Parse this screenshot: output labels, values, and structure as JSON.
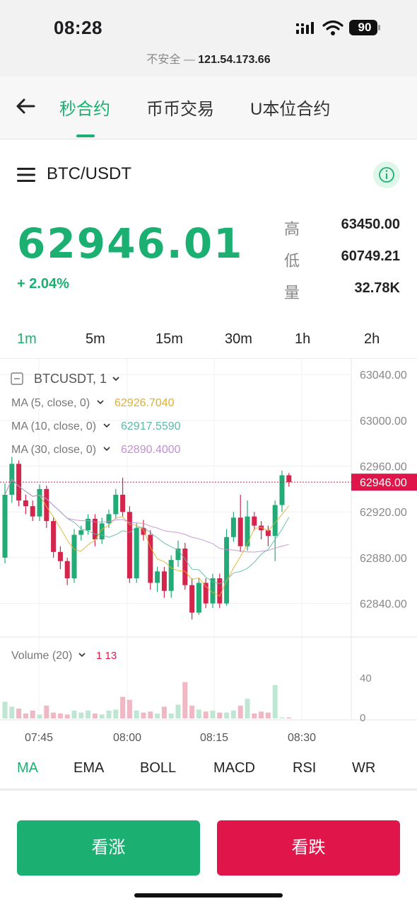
{
  "status_bar": {
    "time": "08:28",
    "battery": "90"
  },
  "url_bar": {
    "insecure": "不安全 — ",
    "address": "121.54.173.66"
  },
  "nav": {
    "tabs": [
      "秒合约",
      "币币交易",
      "U本位合约"
    ],
    "active": 0
  },
  "pair": "BTC/USDT",
  "ticker": {
    "price": "62946.01",
    "change": "+ 2.04%",
    "high_label": "高",
    "high": "63450.00",
    "low_label": "低",
    "low": "60749.21",
    "vol_label": "量",
    "vol": "32.78K"
  },
  "timeframes": [
    "1m",
    "5m",
    "15m",
    "30m",
    "1h",
    "2h"
  ],
  "indicators": [
    "MA",
    "EMA",
    "BOLL",
    "MACD",
    "RSI",
    "WR"
  ],
  "buttons": {
    "up": "看涨",
    "down": "看跌"
  },
  "colors": {
    "up": "#1bb072",
    "down": "#e0164a",
    "chart_up": "#22ab76",
    "chart_down": "#d4254c"
  },
  "chart_data": {
    "type": "candlestick",
    "symbol": "BTCUSDT, 1",
    "ma": [
      {
        "name": "MA (5, close, 0)",
        "value": "62926.7040",
        "color": "#e0b12b"
      },
      {
        "name": "MA (10, close, 0)",
        "value": "62917.5590",
        "color": "#5fb9a8"
      },
      {
        "name": "MA (30, close, 0)",
        "value": "62890.4000",
        "color": "#c28fd1"
      }
    ],
    "y_ticks": [
      "63040.00",
      "63000.00",
      "62960.00",
      "62920.00",
      "62880.00",
      "62840.00"
    ],
    "y_range": [
      62815,
      63050
    ],
    "last_price_label": "62946.00",
    "last_price": 62946,
    "x_ticks": [
      "07:45",
      "08:00",
      "08:15",
      "08:30"
    ],
    "volume_label": "Volume (20)",
    "volume_values": "1 13",
    "volume_ticks": [
      "40",
      "0"
    ],
    "candles": [
      {
        "o": 62880,
        "c": 62935,
        "h": 62945,
        "l": 62875
      },
      {
        "o": 62935,
        "c": 62962,
        "h": 62968,
        "l": 62928
      },
      {
        "o": 62962,
        "c": 62930,
        "h": 62965,
        "l": 62925
      },
      {
        "o": 62930,
        "c": 62925,
        "h": 62935,
        "l": 62918
      },
      {
        "o": 62925,
        "c": 62916,
        "h": 62930,
        "l": 62912
      },
      {
        "o": 62916,
        "c": 62940,
        "h": 62944,
        "l": 62912
      },
      {
        "o": 62940,
        "c": 62912,
        "h": 62943,
        "l": 62906
      },
      {
        "o": 62912,
        "c": 62885,
        "h": 62915,
        "l": 62880
      },
      {
        "o": 62885,
        "c": 62877,
        "h": 62890,
        "l": 62870
      },
      {
        "o": 62877,
        "c": 62862,
        "h": 62880,
        "l": 62856
      },
      {
        "o": 62862,
        "c": 62900,
        "h": 62905,
        "l": 62858
      },
      {
        "o": 62900,
        "c": 62904,
        "h": 62908,
        "l": 62895
      },
      {
        "o": 62904,
        "c": 62914,
        "h": 62918,
        "l": 62900
      },
      {
        "o": 62914,
        "c": 62896,
        "h": 62918,
        "l": 62890
      },
      {
        "o": 62896,
        "c": 62910,
        "h": 62915,
        "l": 62892
      },
      {
        "o": 62910,
        "c": 62918,
        "h": 62922,
        "l": 62906
      },
      {
        "o": 62918,
        "c": 62935,
        "h": 62940,
        "l": 62914
      },
      {
        "o": 62935,
        "c": 62920,
        "h": 62950,
        "l": 62916
      },
      {
        "o": 62920,
        "c": 62862,
        "h": 62925,
        "l": 62858
      },
      {
        "o": 62862,
        "c": 62906,
        "h": 62910,
        "l": 62858
      },
      {
        "o": 62906,
        "c": 62900,
        "h": 62913,
        "l": 62895
      },
      {
        "o": 62900,
        "c": 62858,
        "h": 62904,
        "l": 62852
      },
      {
        "o": 62858,
        "c": 62868,
        "h": 62872,
        "l": 62850
      },
      {
        "o": 62868,
        "c": 62851,
        "h": 62872,
        "l": 62845
      },
      {
        "o": 62851,
        "c": 62878,
        "h": 62882,
        "l": 62845
      },
      {
        "o": 62878,
        "c": 62888,
        "h": 62895,
        "l": 62872
      },
      {
        "o": 62888,
        "c": 62856,
        "h": 62893,
        "l": 62852
      },
      {
        "o": 62856,
        "c": 62832,
        "h": 62862,
        "l": 62826
      },
      {
        "o": 62832,
        "c": 62858,
        "h": 62862,
        "l": 62830
      },
      {
        "o": 62858,
        "c": 62840,
        "h": 62862,
        "l": 62836
      },
      {
        "o": 62840,
        "c": 62862,
        "h": 62866,
        "l": 62836
      },
      {
        "o": 62862,
        "c": 62840,
        "h": 62866,
        "l": 62836
      },
      {
        "o": 62840,
        "c": 62898,
        "h": 62905,
        "l": 62838
      },
      {
        "o": 62898,
        "c": 62915,
        "h": 62920,
        "l": 62894
      },
      {
        "o": 62915,
        "c": 62890,
        "h": 62935,
        "l": 62885
      },
      {
        "o": 62890,
        "c": 62916,
        "h": 62930,
        "l": 62886
      },
      {
        "o": 62916,
        "c": 62908,
        "h": 62920,
        "l": 62904
      },
      {
        "o": 62908,
        "c": 62904,
        "h": 62912,
        "l": 62896
      },
      {
        "o": 62904,
        "c": 62899,
        "h": 62908,
        "l": 62890
      },
      {
        "o": 62899,
        "c": 62926,
        "h": 62930,
        "l": 62877
      },
      {
        "o": 62926,
        "c": 62952,
        "h": 62956,
        "l": 62920
      },
      {
        "o": 62952,
        "c": 62946,
        "h": 62954,
        "l": 62942
      }
    ],
    "volume": [
      17,
      12,
      10,
      5,
      8,
      4,
      13,
      6,
      5,
      4,
      8,
      6,
      8,
      5,
      4,
      8,
      9,
      22,
      19,
      8,
      6,
      7,
      5,
      12,
      5,
      14,
      37,
      13,
      9,
      7,
      8,
      6,
      6,
      8,
      13,
      20,
      5,
      7,
      6,
      34,
      1,
      1
    ]
  }
}
